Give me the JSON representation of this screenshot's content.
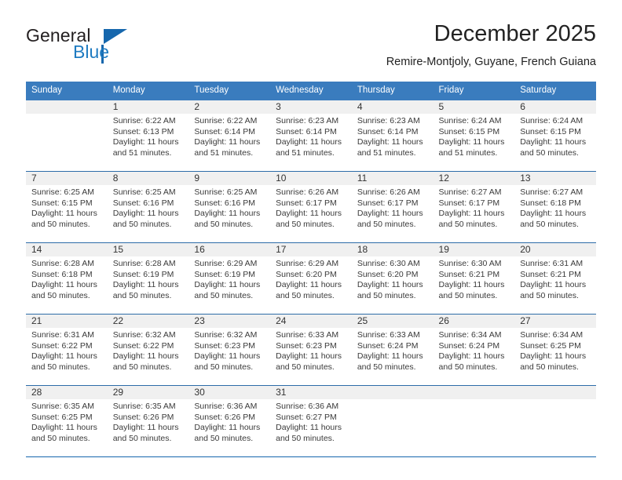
{
  "brand": {
    "name_part1": "General",
    "name_part2": "Blue",
    "logo_icon": "triangle-flag-icon",
    "accent_color": "#1667ad"
  },
  "header": {
    "title": "December 2025",
    "subtitle": "Remire-Montjoly, Guyane, French Guiana"
  },
  "calendar": {
    "header_bg": "#3a7cbe",
    "daynum_bg": "#f0f0f0",
    "grid_line_color": "#1667ad",
    "weekday_headers": [
      "Sunday",
      "Monday",
      "Tuesday",
      "Wednesday",
      "Thursday",
      "Friday",
      "Saturday"
    ],
    "weeks": [
      [
        {
          "day": "",
          "sunrise": "",
          "sunset": "",
          "daylight1": "",
          "daylight2": ""
        },
        {
          "day": "1",
          "sunrise": "Sunrise: 6:22 AM",
          "sunset": "Sunset: 6:13 PM",
          "daylight1": "Daylight: 11 hours",
          "daylight2": "and 51 minutes."
        },
        {
          "day": "2",
          "sunrise": "Sunrise: 6:22 AM",
          "sunset": "Sunset: 6:14 PM",
          "daylight1": "Daylight: 11 hours",
          "daylight2": "and 51 minutes."
        },
        {
          "day": "3",
          "sunrise": "Sunrise: 6:23 AM",
          "sunset": "Sunset: 6:14 PM",
          "daylight1": "Daylight: 11 hours",
          "daylight2": "and 51 minutes."
        },
        {
          "day": "4",
          "sunrise": "Sunrise: 6:23 AM",
          "sunset": "Sunset: 6:14 PM",
          "daylight1": "Daylight: 11 hours",
          "daylight2": "and 51 minutes."
        },
        {
          "day": "5",
          "sunrise": "Sunrise: 6:24 AM",
          "sunset": "Sunset: 6:15 PM",
          "daylight1": "Daylight: 11 hours",
          "daylight2": "and 51 minutes."
        },
        {
          "day": "6",
          "sunrise": "Sunrise: 6:24 AM",
          "sunset": "Sunset: 6:15 PM",
          "daylight1": "Daylight: 11 hours",
          "daylight2": "and 50 minutes."
        }
      ],
      [
        {
          "day": "7",
          "sunrise": "Sunrise: 6:25 AM",
          "sunset": "Sunset: 6:15 PM",
          "daylight1": "Daylight: 11 hours",
          "daylight2": "and 50 minutes."
        },
        {
          "day": "8",
          "sunrise": "Sunrise: 6:25 AM",
          "sunset": "Sunset: 6:16 PM",
          "daylight1": "Daylight: 11 hours",
          "daylight2": "and 50 minutes."
        },
        {
          "day": "9",
          "sunrise": "Sunrise: 6:25 AM",
          "sunset": "Sunset: 6:16 PM",
          "daylight1": "Daylight: 11 hours",
          "daylight2": "and 50 minutes."
        },
        {
          "day": "10",
          "sunrise": "Sunrise: 6:26 AM",
          "sunset": "Sunset: 6:17 PM",
          "daylight1": "Daylight: 11 hours",
          "daylight2": "and 50 minutes."
        },
        {
          "day": "11",
          "sunrise": "Sunrise: 6:26 AM",
          "sunset": "Sunset: 6:17 PM",
          "daylight1": "Daylight: 11 hours",
          "daylight2": "and 50 minutes."
        },
        {
          "day": "12",
          "sunrise": "Sunrise: 6:27 AM",
          "sunset": "Sunset: 6:17 PM",
          "daylight1": "Daylight: 11 hours",
          "daylight2": "and 50 minutes."
        },
        {
          "day": "13",
          "sunrise": "Sunrise: 6:27 AM",
          "sunset": "Sunset: 6:18 PM",
          "daylight1": "Daylight: 11 hours",
          "daylight2": "and 50 minutes."
        }
      ],
      [
        {
          "day": "14",
          "sunrise": "Sunrise: 6:28 AM",
          "sunset": "Sunset: 6:18 PM",
          "daylight1": "Daylight: 11 hours",
          "daylight2": "and 50 minutes."
        },
        {
          "day": "15",
          "sunrise": "Sunrise: 6:28 AM",
          "sunset": "Sunset: 6:19 PM",
          "daylight1": "Daylight: 11 hours",
          "daylight2": "and 50 minutes."
        },
        {
          "day": "16",
          "sunrise": "Sunrise: 6:29 AM",
          "sunset": "Sunset: 6:19 PM",
          "daylight1": "Daylight: 11 hours",
          "daylight2": "and 50 minutes."
        },
        {
          "day": "17",
          "sunrise": "Sunrise: 6:29 AM",
          "sunset": "Sunset: 6:20 PM",
          "daylight1": "Daylight: 11 hours",
          "daylight2": "and 50 minutes."
        },
        {
          "day": "18",
          "sunrise": "Sunrise: 6:30 AM",
          "sunset": "Sunset: 6:20 PM",
          "daylight1": "Daylight: 11 hours",
          "daylight2": "and 50 minutes."
        },
        {
          "day": "19",
          "sunrise": "Sunrise: 6:30 AM",
          "sunset": "Sunset: 6:21 PM",
          "daylight1": "Daylight: 11 hours",
          "daylight2": "and 50 minutes."
        },
        {
          "day": "20",
          "sunrise": "Sunrise: 6:31 AM",
          "sunset": "Sunset: 6:21 PM",
          "daylight1": "Daylight: 11 hours",
          "daylight2": "and 50 minutes."
        }
      ],
      [
        {
          "day": "21",
          "sunrise": "Sunrise: 6:31 AM",
          "sunset": "Sunset: 6:22 PM",
          "daylight1": "Daylight: 11 hours",
          "daylight2": "and 50 minutes."
        },
        {
          "day": "22",
          "sunrise": "Sunrise: 6:32 AM",
          "sunset": "Sunset: 6:22 PM",
          "daylight1": "Daylight: 11 hours",
          "daylight2": "and 50 minutes."
        },
        {
          "day": "23",
          "sunrise": "Sunrise: 6:32 AM",
          "sunset": "Sunset: 6:23 PM",
          "daylight1": "Daylight: 11 hours",
          "daylight2": "and 50 minutes."
        },
        {
          "day": "24",
          "sunrise": "Sunrise: 6:33 AM",
          "sunset": "Sunset: 6:23 PM",
          "daylight1": "Daylight: 11 hours",
          "daylight2": "and 50 minutes."
        },
        {
          "day": "25",
          "sunrise": "Sunrise: 6:33 AM",
          "sunset": "Sunset: 6:24 PM",
          "daylight1": "Daylight: 11 hours",
          "daylight2": "and 50 minutes."
        },
        {
          "day": "26",
          "sunrise": "Sunrise: 6:34 AM",
          "sunset": "Sunset: 6:24 PM",
          "daylight1": "Daylight: 11 hours",
          "daylight2": "and 50 minutes."
        },
        {
          "day": "27",
          "sunrise": "Sunrise: 6:34 AM",
          "sunset": "Sunset: 6:25 PM",
          "daylight1": "Daylight: 11 hours",
          "daylight2": "and 50 minutes."
        }
      ],
      [
        {
          "day": "28",
          "sunrise": "Sunrise: 6:35 AM",
          "sunset": "Sunset: 6:25 PM",
          "daylight1": "Daylight: 11 hours",
          "daylight2": "and 50 minutes."
        },
        {
          "day": "29",
          "sunrise": "Sunrise: 6:35 AM",
          "sunset": "Sunset: 6:26 PM",
          "daylight1": "Daylight: 11 hours",
          "daylight2": "and 50 minutes."
        },
        {
          "day": "30",
          "sunrise": "Sunrise: 6:36 AM",
          "sunset": "Sunset: 6:26 PM",
          "daylight1": "Daylight: 11 hours",
          "daylight2": "and 50 minutes."
        },
        {
          "day": "31",
          "sunrise": "Sunrise: 6:36 AM",
          "sunset": "Sunset: 6:27 PM",
          "daylight1": "Daylight: 11 hours",
          "daylight2": "and 50 minutes."
        },
        {
          "day": "",
          "sunrise": "",
          "sunset": "",
          "daylight1": "",
          "daylight2": ""
        },
        {
          "day": "",
          "sunrise": "",
          "sunset": "",
          "daylight1": "",
          "daylight2": ""
        },
        {
          "day": "",
          "sunrise": "",
          "sunset": "",
          "daylight1": "",
          "daylight2": ""
        }
      ]
    ]
  }
}
